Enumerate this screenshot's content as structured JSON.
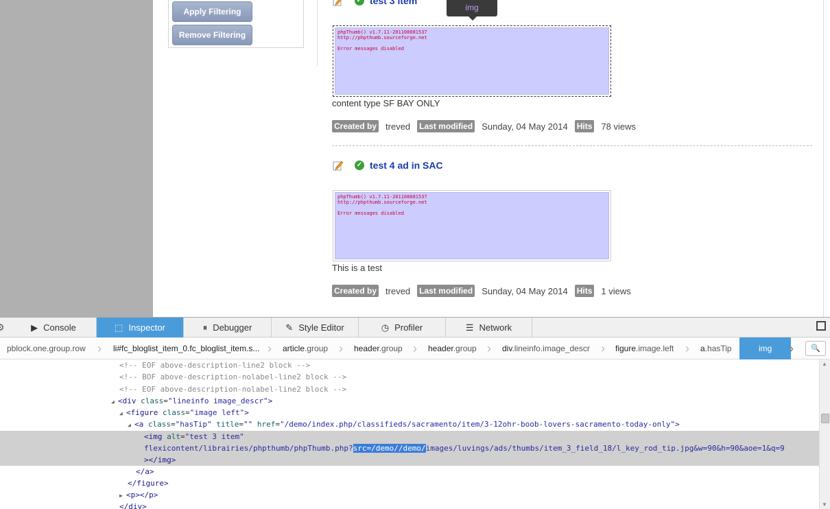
{
  "page": {
    "filter": {
      "apply_label": "Apply Filtering",
      "remove_label": "Remove Filtering"
    },
    "tooltip": "img",
    "items": [
      {
        "title": "test 3 item",
        "thumb_lines": [
          "phpThumb() v1.7.11-201108081537",
          "http://phpthumb.sourceforge.net",
          "",
          "Error messages disabled"
        ],
        "description": "content type SF BAY ONLY",
        "created_by_label": "Created by",
        "created_by": "treved",
        "modified_label": "Last modified",
        "modified": "Sunday, 04 May 2014",
        "hits_label": "Hits",
        "hits": "78 views"
      },
      {
        "title": "test 4 ad in SAC",
        "thumb_lines": [
          "phpThumb() v1.7.11-201108081537",
          "http://phpthumb.sourceforge.net",
          "",
          "Error messages disabled"
        ],
        "description": "This is a test",
        "created_by_label": "Created by",
        "created_by": "treved",
        "modified_label": "Last modified",
        "modified": "Sunday, 04 May 2014",
        "hits_label": "Hits",
        "hits": "1 views"
      }
    ]
  },
  "devtools": {
    "tabs": [
      {
        "label": "Console",
        "icon": "console-icon"
      },
      {
        "label": "Inspector",
        "icon": "inspector-icon"
      },
      {
        "label": "Debugger",
        "icon": "debugger-icon"
      },
      {
        "label": "Style Editor",
        "icon": "style-editor-icon"
      },
      {
        "label": "Profiler",
        "icon": "profiler-icon"
      },
      {
        "label": "Network",
        "icon": "network-icon"
      }
    ],
    "active_tab": "Inspector",
    "breadcrumbs": [
      {
        "tag": "",
        "cls": "pblock.one.group.row"
      },
      {
        "tag": "li#fc_bloglist_item_0.fc_bloglist_item.s...",
        "cls": ""
      },
      {
        "tag": "article",
        "cls": ".group"
      },
      {
        "tag": "header",
        "cls": ".group"
      },
      {
        "tag": "header",
        "cls": ".group"
      },
      {
        "tag": "div",
        "cls": ".lineinfo.image_descr"
      },
      {
        "tag": "figure",
        "cls": ".image.left"
      },
      {
        "tag": "a",
        "cls": ".hasTip"
      },
      {
        "tag": "img",
        "cls": ""
      }
    ],
    "markup": {
      "c1": "<!-- EOF above-description-line2 block -->",
      "c2": "<!-- BOF above-description-nolabel-line2 block -->",
      "c3": "<!-- EOF above-description-nolabel-line2 block -->",
      "div_open_tag": "<div",
      "div_attr": "class",
      "div_val": "\"lineinfo image_descr\"",
      "fig_tag": "<figure",
      "fig_attr": "class",
      "fig_val": "\"image left\"",
      "a_tag": "<a",
      "a_attr1": "class",
      "a_val1": "\"hasTip\"",
      "a_attr2": "title",
      "a_val2": "\"\"",
      "a_attr3": "href",
      "a_val3": "\"/demo/index.php/classifieds/sacramento/item/3-12ohr-boob-lovers-sacramento-today-only\"",
      "img_tag": "<img",
      "img_attr": "alt",
      "img_val": "\"test 3 item\"",
      "src_pre": "flexicontent/librairies/phpthumb/phpThumb.php?",
      "src_hl": "src=/demo//demo/",
      "src_post": "images/luvings/ads/thumbs/item_3_field_18/l_key_rod_tip.jpg&w=90&h=90&aoe=1&q=9",
      "img_close": "></img>",
      "a_close": "</a>",
      "fig_close": "</figure>",
      "p_line": "<p></p>",
      "div_close": "</div>"
    }
  }
}
